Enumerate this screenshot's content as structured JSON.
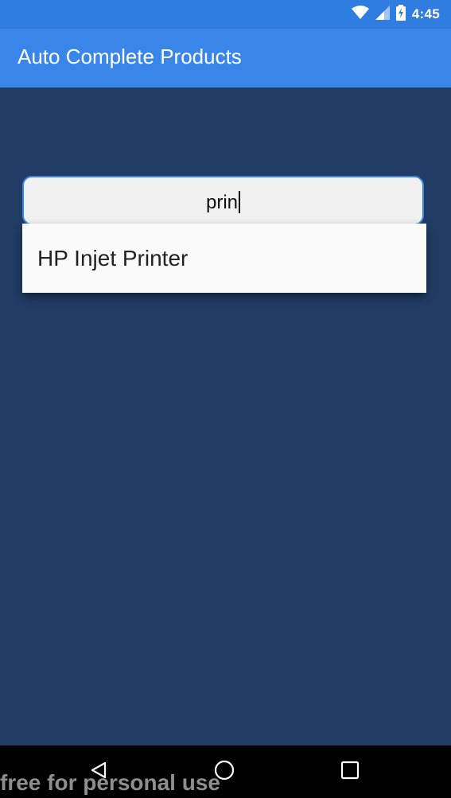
{
  "status_bar": {
    "time": "4:45",
    "icons": [
      "wifi-icon",
      "cell-signal-icon",
      "battery-charging-icon"
    ]
  },
  "app_bar": {
    "title": "Auto Complete Products",
    "color": "#3a86e8"
  },
  "search": {
    "value": "prin"
  },
  "suggestions": {
    "items": [
      {
        "label": "HP Injet Printer"
      }
    ]
  },
  "nav_bar": {
    "icons": [
      "back-icon",
      "home-icon",
      "recents-icon"
    ]
  },
  "watermark": {
    "text": "free for personal use"
  },
  "colors": {
    "background": "#213d66",
    "accent": "#3a86e8",
    "status_bar": "#2f7de1"
  }
}
